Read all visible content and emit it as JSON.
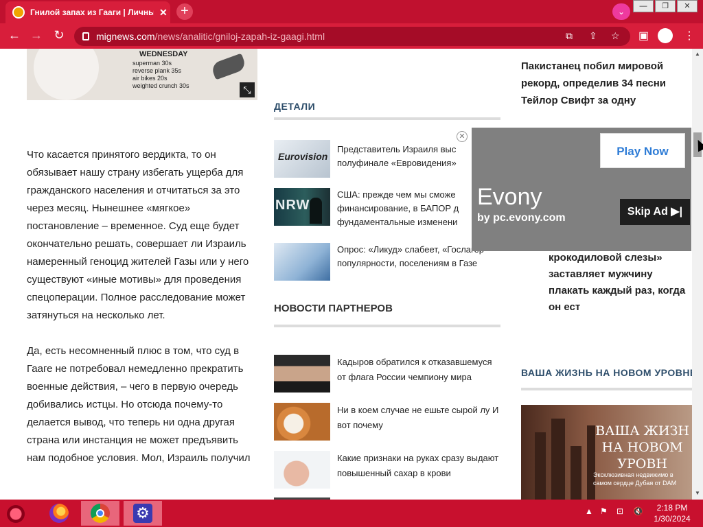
{
  "browser": {
    "tab_title": "Гнилой запах из Гааги | Личный",
    "tab_close": "✕",
    "new_tab": "+",
    "profile_menu": "⌄",
    "window_minimize": "—",
    "window_restore": "❐",
    "window_close": "✕",
    "url_host": "mignews.com",
    "url_path": "/news/analitic/gniloj-zapah-iz-gaagi.html",
    "icons": [
      "back-icon",
      "forward-icon",
      "reload-icon",
      "lock-icon",
      "translate-icon",
      "share-icon",
      "bookmark-star-icon",
      "side-panel-icon",
      "profile-icon",
      "menu-icon"
    ]
  },
  "top_image": {
    "day": "WEDNESDAY",
    "exercises": [
      "superman 30s",
      "reverse plank 35s",
      "air bikes 20s",
      "weighted crunch 30s"
    ]
  },
  "article": {
    "paragraphs": [
      "Что касается принятого вердикта, то он обязывает нашу страну избегать ущерба для гражданского населения и отчитаться за это через месяц. Нынешнее «мягкое» постановление – временное. Суд еще будет окончательно решать, совершает ли Израиль намеренный геноцид жителей Газы или у него существуют «иные мотивы» для проведения спецоперации. Полное расследование может затянуться на несколько лет.",
      "Да, есть несомненный плюс в том, что суд в Гааге не потребовал немедленно прекратить военные действия, – чего в первую очередь добивались истцы. Но отсюда почему-то делается вывод, что теперь ни одна другая страна или инстанция не может предъявить нам подобное условия. Мол, Израиль получил"
    ]
  },
  "details": {
    "heading": "ДЕТАЛИ",
    "items": [
      {
        "text": "Представитель Израиля выс полуфинале «Евровидения»",
        "thumb_label": "Eurovision"
      },
      {
        "text": "США: прежде чем мы сможе финансирование, в БАПОР д фундаментальные изменени",
        "thumb_label": "NRWA"
      },
      {
        "text": "Опрос: «Ликуд» слабеет, «Гослагер популярности, поселениям в Газе"
      }
    ]
  },
  "partners": {
    "heading": "НОВОСТИ ПАРТНЕРОВ",
    "items": [
      {
        "text": "Кадыров обратился к отказавшемуся от флага России чемпиону мира"
      },
      {
        "text": "Ни в коем случае не ешьте сырой лу И вот почему"
      },
      {
        "text": "Какие признаки на руках сразу выдают повышенный сахар в крови"
      }
    ]
  },
  "sidebar": {
    "title1": "Пакистанец побил мировой рекорд, определив 34 песни Тейлор Свифт за одну",
    "title2": "крокодиловой слезы» заставляет мужчину плакать каждый раз, когда он ест",
    "section": "ВАША ЖИЗНЬ НА НОВОМ УРОВНЕ",
    "promo_heading_lines": [
      "ВАША ЖИЗН",
      "НА НОВОМ",
      "УРОВН"
    ],
    "promo_sub": "Эксклюзивная недвижимо в самом сердце Дубая от DAM"
  },
  "ad": {
    "close": "✕",
    "play_now": "Play Now",
    "brand": "Evony",
    "byline": "by pc.evony.com",
    "skip": "Skip Ad ▶|"
  },
  "taskbar": {
    "apps": [
      "firefox-icon",
      "chrome-icon",
      "settings-icon"
    ],
    "time": "2:18 PM",
    "date": "1/30/2024"
  },
  "colors": {
    "chrome_red": "#d81e3b",
    "title_red": "#c0112f",
    "section_blue": "#2d4d6a",
    "ad_gray": "#808080",
    "play_blue": "#2e7cd6"
  }
}
